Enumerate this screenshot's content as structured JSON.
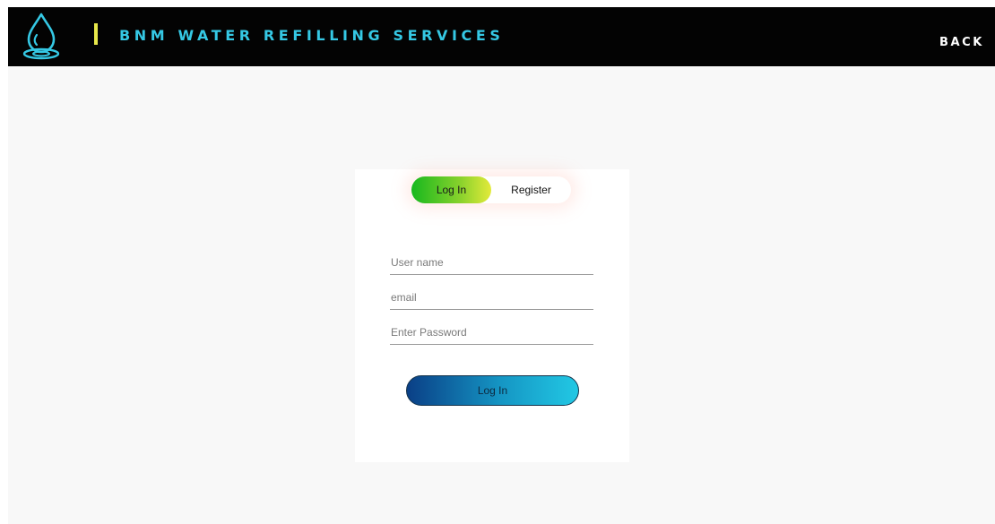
{
  "header": {
    "brand_title": "BNM WATER REFILLING SERVICES",
    "back_label": "BACK",
    "logo_icon": "water-drop-icon",
    "colors": {
      "background": "#030303",
      "brand_text": "#35c8e4",
      "divider": "#e8e84a",
      "back_text": "#ffffff"
    }
  },
  "auth": {
    "tabs": {
      "login_label": "Log In",
      "register_label": "Register",
      "active": "Log In"
    },
    "fields": {
      "username": {
        "value": "",
        "placeholder": "User name"
      },
      "email": {
        "value": "",
        "placeholder": "email"
      },
      "password": {
        "value": "",
        "placeholder": "Enter Password"
      }
    },
    "submit_label": "Log In",
    "colors": {
      "login_tab_gradient": [
        "#17b81e",
        "#e3ea3a"
      ],
      "submit_gradient": [
        "#0a3f86",
        "#22c8e4"
      ]
    }
  }
}
